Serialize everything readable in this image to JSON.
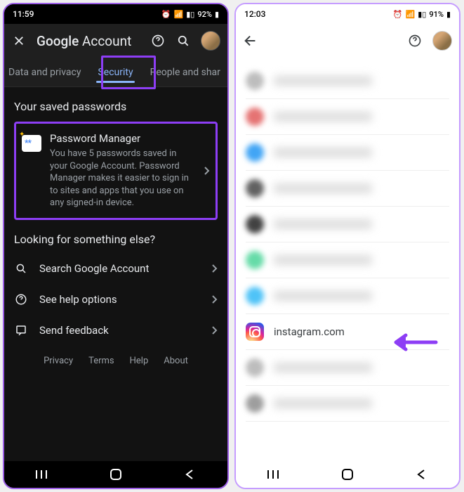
{
  "left": {
    "status": {
      "time": "11:59",
      "battery": "92%"
    },
    "appbar": {
      "title_bold": "Google",
      "title_rest": " Account"
    },
    "tabs": [
      "Data and privacy",
      "Security",
      "People and shar"
    ],
    "section1_title": "Your saved passwords",
    "pm": {
      "title": "Password Manager",
      "desc": "You have 5 passwords saved in your Google Account. Password Manager makes it easier to sign in to sites and apps that you use on any signed-in device."
    },
    "section2_title": "Looking for something else?",
    "actions": {
      "search": "Search Google Account",
      "help": "See help options",
      "feedback": "Send feedback"
    },
    "footer": [
      "Privacy",
      "Terms",
      "Help",
      "About"
    ]
  },
  "right": {
    "status": {
      "time": "12:03",
      "battery": "91%"
    },
    "highlighted_site": "instagram.com"
  }
}
